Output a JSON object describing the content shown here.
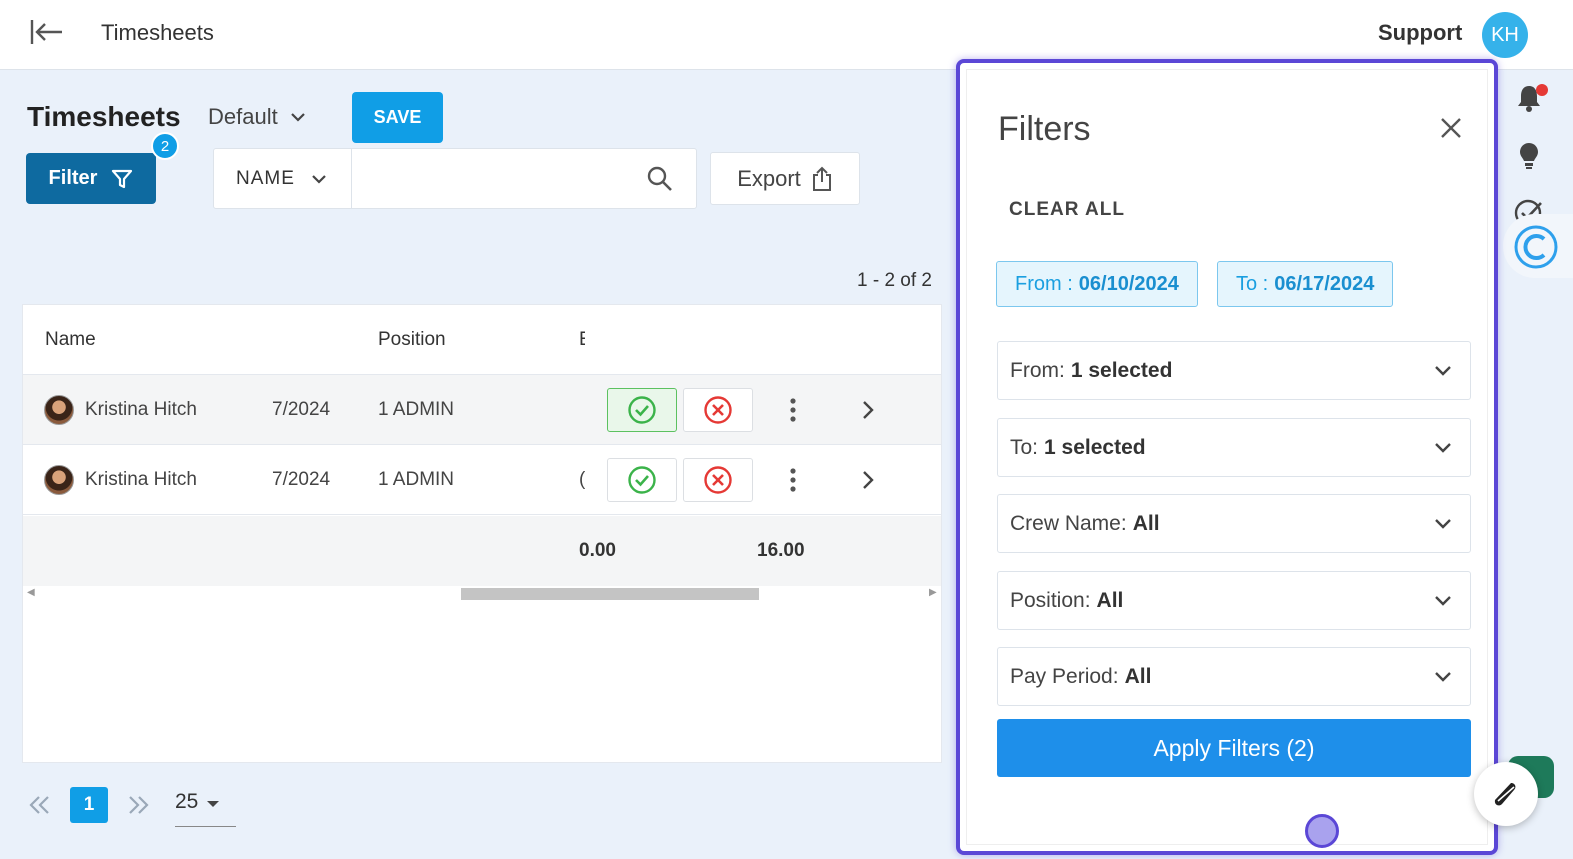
{
  "topbar": {
    "title": "Timesheets",
    "support_label": "Support",
    "avatar_initials": "KH"
  },
  "page": {
    "title": "Timesheets",
    "view_name": "Default",
    "save_label": "SAVE",
    "filter_label": "Filter",
    "filter_count": "2",
    "export_label": "Export"
  },
  "search": {
    "field": "NAME",
    "value": "",
    "placeholder": ""
  },
  "results_count": "1 - 2 of 2",
  "table": {
    "columns": [
      "Name",
      "Position",
      "E"
    ],
    "rows": [
      {
        "name": "Kristina Hitch",
        "date": "7/2024",
        "position": "1 ADMIN",
        "extra": "",
        "approved": true
      },
      {
        "name": "Kristina Hitch",
        "date": "7/2024",
        "position": "1 ADMIN",
        "extra": "(",
        "approved": false
      }
    ],
    "totals": [
      "0.00",
      "16.00"
    ]
  },
  "pagination": {
    "current_page": "1",
    "page_size": "25"
  },
  "filters_panel": {
    "title": "Filters",
    "clear_all": "CLEAR ALL",
    "chips": [
      {
        "label": "From :",
        "value": "06/10/2024"
      },
      {
        "label": "To :",
        "value": "06/17/2024"
      }
    ],
    "dropdowns": [
      {
        "label": "From:",
        "value": "1 selected"
      },
      {
        "label": "To:",
        "value": "1 selected"
      },
      {
        "label": "Crew Name:",
        "value": "All"
      },
      {
        "label": "Position:",
        "value": "All"
      },
      {
        "label": "Pay Period:",
        "value": "All"
      }
    ],
    "apply_label": "Apply Filters (2)"
  },
  "colors": {
    "accent": "#109ee6",
    "filter_button": "#0e6aa0",
    "apply_button": "#1e8fea",
    "panel_border": "#5b47d6",
    "approve": "#3bb34a",
    "reject": "#e53935"
  }
}
